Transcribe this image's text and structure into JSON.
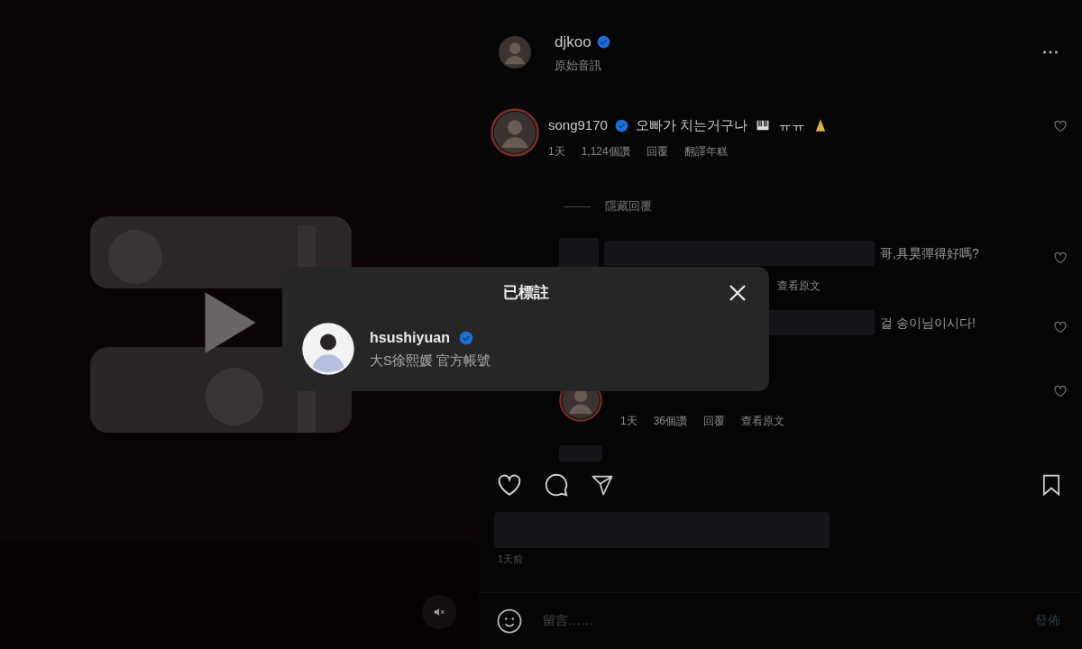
{
  "post_header": {
    "username": "djkoo",
    "verified": true,
    "audio": "原始音訊"
  },
  "comments": [
    {
      "kind": "comment",
      "username": "song9170",
      "verified": true,
      "parts": [
        {
          "kind": "text",
          "value": "오빠가 치는거구나"
        },
        {
          "kind": "piano"
        },
        {
          "kind": "text",
          "value": "ㅠㅠ"
        },
        {
          "kind": "pray"
        }
      ],
      "meta": [
        "1天",
        "1,124個讚",
        "回覆",
        "翻譯年糕"
      ]
    },
    {
      "kind": "toggle",
      "label": "隱藏回覆"
    },
    {
      "kind": "reply",
      "text": "哥,具昊彈得好嗎?",
      "meta": [
        "查看原文"
      ]
    },
    {
      "kind": "reply",
      "text": "걸 송이님이시다!"
    },
    {
      "kind": "reply_partial",
      "meta": [
        "1天",
        "36個讚",
        "回覆",
        "查看原文"
      ]
    },
    {
      "kind": "blurred"
    }
  ],
  "date": "1天前",
  "composer": {
    "placeholder": "留言……",
    "submit": "發佈"
  },
  "modal": {
    "title": "已標註",
    "users": [
      {
        "username": "hsushiyuan",
        "verified": true,
        "subtitle": "大S徐熙媛 官方帳號"
      }
    ]
  }
}
